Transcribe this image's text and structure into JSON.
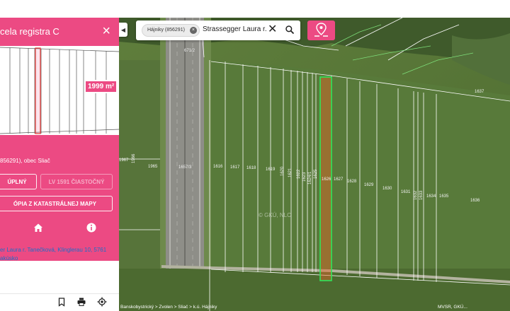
{
  "colors": {
    "accent": "#ec4a83",
    "parcel_highlight": "#2ee65a",
    "link": "#1a6fc9"
  },
  "panel": {
    "title": "cela registra C",
    "close_icon": "close-icon",
    "area_badge": "1999 m²",
    "location": "856291), obec Sliač",
    "buttons": {
      "full": "ÚPLNÝ",
      "partial": "LV 1591 ČIASTOČNÝ",
      "copy": "ÓPIA Z KATASTRÁLNEJ MAPY"
    },
    "tabs": [
      "home-icon",
      "info-icon"
    ],
    "owner_lines": [
      "er Laura r. Tanečková, Klinglerau 10, 5761",
      "akúsko"
    ],
    "footer_icons": [
      "bookmark-icon",
      "print-icon",
      "target-icon"
    ]
  },
  "search": {
    "chip": "Hájniky (856291)",
    "query": "Strassegger Laura r.",
    "clear_icon": "close-icon",
    "submit_icon": "search-icon"
  },
  "map": {
    "parcels": [
      "1967",
      "1966",
      "1965",
      "1657/3",
      "1616",
      "1617",
      "1618",
      "1619",
      "1620",
      "1621",
      "1622",
      "1623",
      "1624/1",
      "1625",
      "1626",
      "1627",
      "1628",
      "1629",
      "1630",
      "1631",
      "1632",
      "1633",
      "1634",
      "1635",
      "1636",
      "1637",
      "671/2"
    ],
    "breadcrumb": "Banskobystrický > Zvolen > Sliač > k.ú. Hájniky",
    "attribution": "MVSR, GKÚ...",
    "watermark": "© GKÚ, NLC"
  }
}
